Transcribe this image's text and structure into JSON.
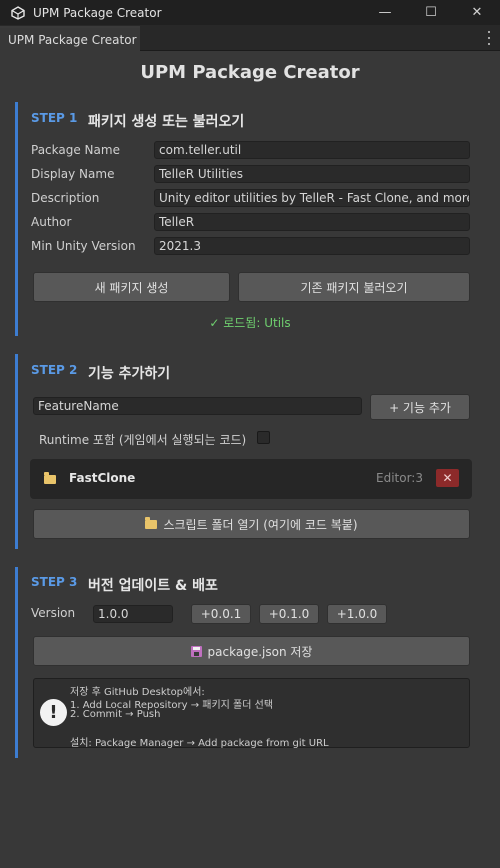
{
  "window": {
    "title": "UPM Package Creator",
    "minimize": "—",
    "maximize": "☐",
    "close": "✕"
  },
  "tab": {
    "label": "UPM Package Creator"
  },
  "main_title": "UPM Package Creator",
  "step1": {
    "label": "STEP 1",
    "title": "패키지 생성 또는 불러오기",
    "fields": [
      {
        "label": "Package Name",
        "value": "com.teller.util"
      },
      {
        "label": "Display Name",
        "value": "TelleR Utilities"
      },
      {
        "label": "Description",
        "value": "Unity editor utilities by TelleR - Fast Clone, and more"
      },
      {
        "label": "Author",
        "value": "TelleR"
      },
      {
        "label": "Min Unity Version",
        "value": "2021.3"
      }
    ],
    "create_button": "새 패키지 생성",
    "load_button": "기존 패키지 불러오기",
    "status": "✓ 로드됨: Utils"
  },
  "step2": {
    "label": "STEP 2",
    "title": "기능 추가하기",
    "feature_input": "FeatureName",
    "add_button": "+ 기능 추가",
    "runtime_label": "Runtime 포함 (게임에서 실행되는 코드)",
    "features": [
      {
        "name": "FastClone",
        "info": "Editor:3",
        "delete": "✕"
      }
    ],
    "open_folder_button": "스크립트 폴더 열기 (여기에 코드 복붙)"
  },
  "step3": {
    "label": "STEP 3",
    "title": "버전 업데이트 & 배포",
    "version_label": "Version",
    "version_value": "1.0.0",
    "bump_patch": "+0.0.1",
    "bump_minor": "+0.1.0",
    "bump_major": "+1.0.0",
    "save_button": "package.json 저장",
    "info_lines": [
      "저장 후 GitHub Desktop에서:",
      "1. Add Local Repository → 패키지 폴더 선택",
      "2. Commit → Push",
      "",
      "설치: Package Manager → Add package from git URL"
    ]
  },
  "colors": {
    "background": "#383838",
    "accent_bar": "#3d7dd1",
    "step_label": "#5a9ae6",
    "status_green": "#6fcf6f",
    "delete_red": "#8c2a2a"
  }
}
